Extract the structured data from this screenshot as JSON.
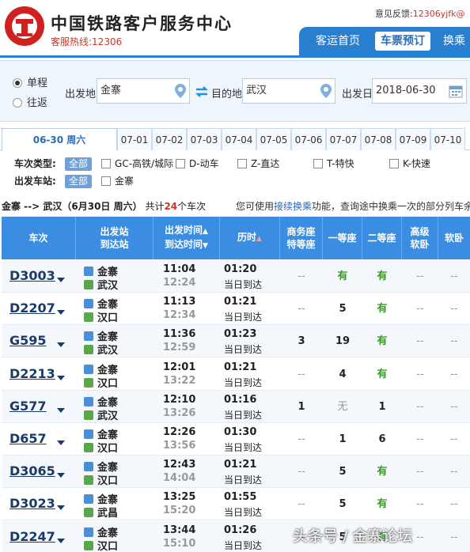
{
  "header": {
    "title": "中国铁路客户服务中心",
    "hotline": "客服热线:12306",
    "feedback_label": "意见反馈:",
    "feedback_email": "12306yjfk@",
    "nav": [
      "客运首页",
      "车票预订",
      "换乘"
    ]
  },
  "search": {
    "trip_types": [
      "单程",
      "往返"
    ],
    "from_label": "出发地",
    "from_value": "金寨",
    "to_label": "目的地",
    "to_value": "武汉",
    "date_label": "出发日",
    "date_value": "2018-06-30"
  },
  "date_tabs": [
    "06-30 周六",
    "07-01",
    "07-02",
    "07-03",
    "07-04",
    "07-05",
    "07-06",
    "07-07",
    "07-08",
    "07-09",
    "07-10"
  ],
  "filters": {
    "type_label": "车次类型:",
    "all_label": "全部",
    "types": [
      "GC-高铁/城际",
      "D-动车",
      "Z-直达",
      "T-特快",
      "K-快速"
    ],
    "station_label": "出发车站:",
    "stations": [
      "金寨"
    ]
  },
  "summary": {
    "route": "金寨 --> 武汉（6月30日  周六）",
    "total_prefix": "共计",
    "count": "24",
    "total_suffix": "个车次",
    "tip_prefix": "您可使用",
    "tip_link": "接续换乘",
    "tip_suffix": "功能，查询途中换乘一次的部分列车余"
  },
  "table": {
    "headers": {
      "train": "车次",
      "station_1": "出发站",
      "station_2": "到达站",
      "time_1": "出发时间",
      "time_2": "到达时间",
      "duration": "历时",
      "business_1": "商务座",
      "business_2": "特等座",
      "first": "一等座",
      "second": "二等座",
      "soft_1": "高级",
      "soft_2": "软卧",
      "softsleeper": "软卧"
    },
    "rows": [
      {
        "no": "D3003",
        "from": "金寨",
        "to": "武汉",
        "dep": "11:04",
        "arr": "12:24",
        "dur": "01:20",
        "day": "当日到达",
        "biz": "--",
        "first": "有",
        "second": "有",
        "h1": "--",
        "h2": "--"
      },
      {
        "no": "D2207",
        "from": "金寨",
        "to": "汉口",
        "dep": "11:13",
        "arr": "12:34",
        "dur": "01:21",
        "day": "当日到达",
        "biz": "--",
        "first": "5",
        "second": "有",
        "h1": "--",
        "h2": "--"
      },
      {
        "no": "G595",
        "from": "金寨",
        "to": "武汉",
        "dep": "11:36",
        "arr": "12:59",
        "dur": "01:23",
        "day": "当日到达",
        "biz": "3",
        "first": "19",
        "second": "有",
        "h1": "--",
        "h2": "--"
      },
      {
        "no": "D2213",
        "from": "金寨",
        "to": "汉口",
        "dep": "12:01",
        "arr": "13:22",
        "dur": "01:21",
        "day": "当日到达",
        "biz": "--",
        "first": "4",
        "second": "有",
        "h1": "--",
        "h2": "--"
      },
      {
        "no": "G577",
        "from": "金寨",
        "to": "武汉",
        "dep": "12:10",
        "arr": "13:26",
        "dur": "01:16",
        "day": "当日到达",
        "biz": "1",
        "first": "无",
        "second": "1",
        "h1": "--",
        "h2": "--"
      },
      {
        "no": "D657",
        "from": "金寨",
        "to": "汉口",
        "dep": "12:26",
        "arr": "13:56",
        "dur": "01:30",
        "day": "当日到达",
        "biz": "--",
        "first": "1",
        "second": "6",
        "h1": "--",
        "h2": "--"
      },
      {
        "no": "D3065",
        "from": "金寨",
        "to": "汉口",
        "dep": "12:43",
        "arr": "14:04",
        "dur": "01:21",
        "day": "当日到达",
        "biz": "--",
        "first": "5",
        "second": "有",
        "h1": "--",
        "h2": "--"
      },
      {
        "no": "D3023",
        "from": "金寨",
        "to": "武昌",
        "dep": "13:25",
        "arr": "15:20",
        "dur": "01:55",
        "day": "当日到达",
        "biz": "--",
        "first": "5",
        "second": "有",
        "h1": "--",
        "h2": "--"
      },
      {
        "no": "D2247",
        "from": "金寨",
        "to": "汉口",
        "dep": "13:44",
        "arr": "15:10",
        "dur": "01:26",
        "day": "当日到达",
        "biz": "--",
        "first": "5",
        "second": "有",
        "h1": "--",
        "h2": "--"
      }
    ]
  },
  "watermark": "头条号 / 金寨论坛",
  "colors": {
    "accent": "#2a7fd0",
    "header_blue": "#3a8de0",
    "available_green": "#3a9a2a",
    "brand_red": "#c0392b"
  }
}
